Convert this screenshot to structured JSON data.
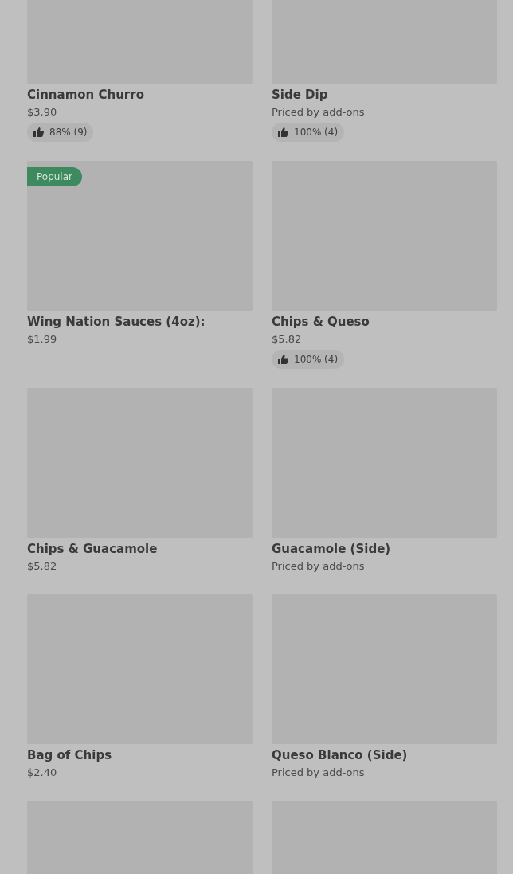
{
  "items": [
    {
      "kind": "product",
      "name": "Cinnamon Churro",
      "price": "$3.90",
      "rating": "88% (9)"
    },
    {
      "kind": "product",
      "name": "Side Dip",
      "price": "Priced by add-ons",
      "rating": "100% (4)"
    },
    {
      "kind": "product",
      "badge": "Popular",
      "name": "Wing Nation Sauces (4oz):",
      "price": "$1.99"
    },
    {
      "kind": "product",
      "name": "Chips & Queso",
      "price": "$5.82",
      "rating": "100% (4)"
    },
    {
      "kind": "product",
      "name": "Chips & Guacamole",
      "price": "$5.82"
    },
    {
      "kind": "product",
      "name": "Guacamole (Side)",
      "price": "Priced by add-ons"
    },
    {
      "kind": "product",
      "name": "Bag of Chips",
      "price": "$2.40"
    },
    {
      "kind": "product",
      "name": "Queso Blanco (Side)",
      "price": "Priced by add-ons"
    },
    {
      "kind": "image-only"
    },
    {
      "kind": "image-only"
    }
  ]
}
